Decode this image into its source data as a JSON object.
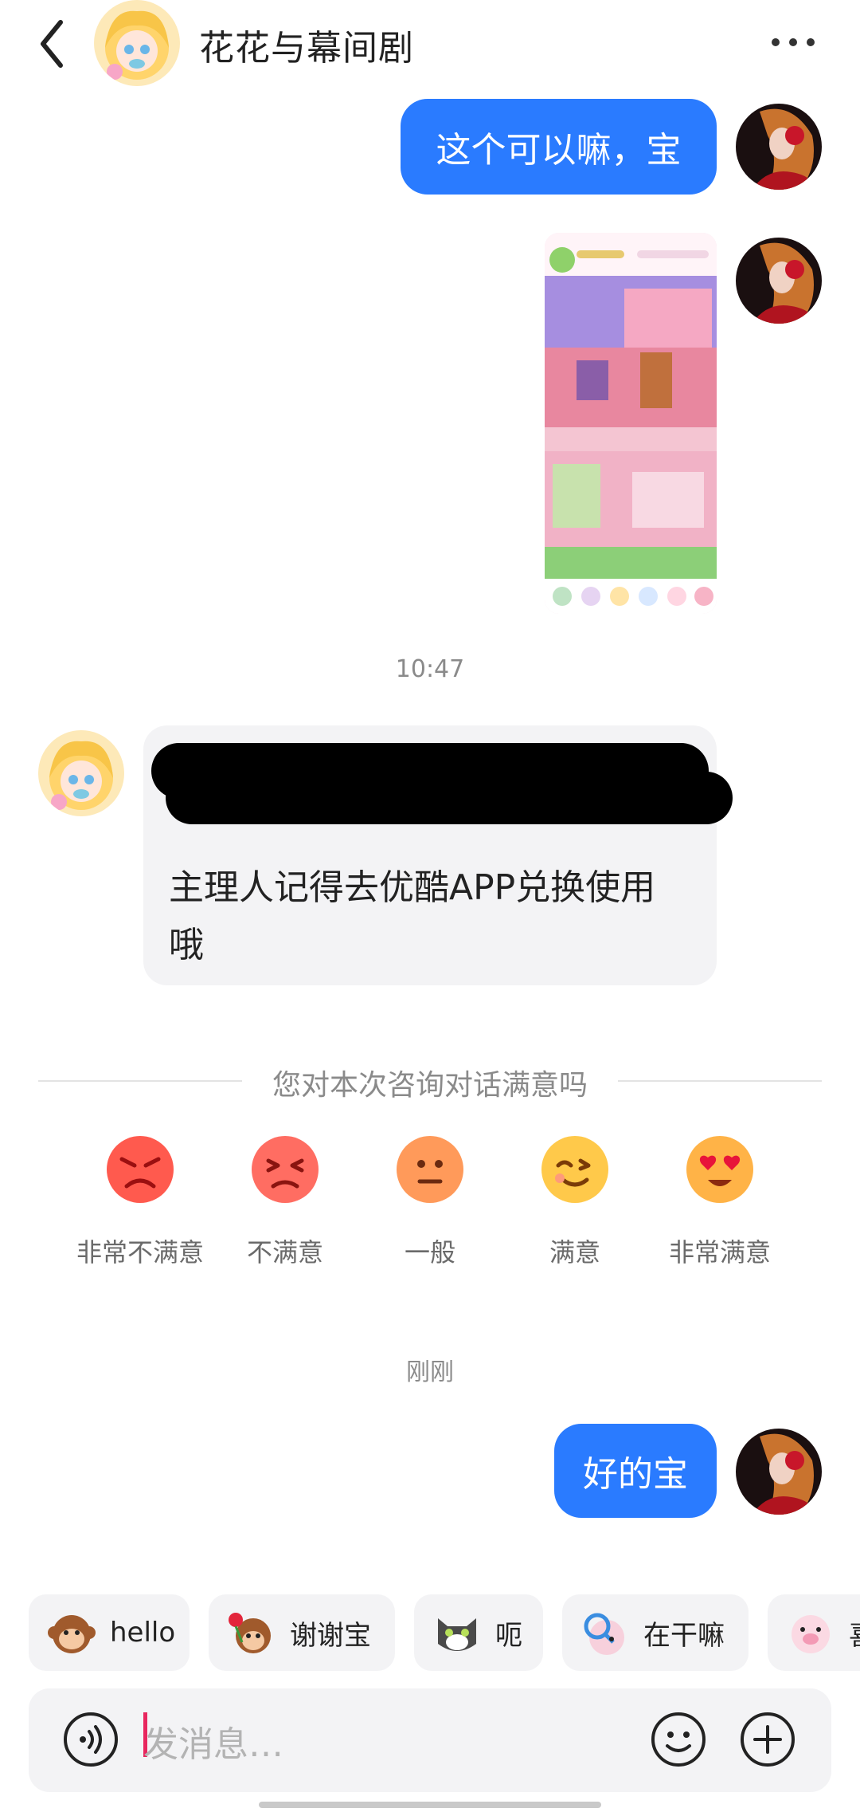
{
  "header": {
    "title": "花花与幕间剧",
    "back_icon": "chevron-left-icon",
    "more_icon": "more-dots-icon"
  },
  "messages": [
    {
      "side": "out",
      "text": "这个可以嘛，宝"
    },
    {
      "side": "out",
      "type": "image",
      "description_icon": "game-screenshot-thumbnail"
    },
    {
      "timestamp": "10:47"
    },
    {
      "side": "in",
      "text_line1": "主理人记得去优酷APP兑换使用",
      "text_line2": "哦"
    },
    {
      "timestamp": "刚刚"
    },
    {
      "side": "out",
      "text": "好的宝"
    }
  ],
  "survey": {
    "title": "您对本次咨询对话满意吗",
    "options": [
      {
        "label": "非常不满意",
        "icon": "angry-face-icon",
        "color": "#ff5a4e"
      },
      {
        "label": "不满意",
        "icon": "frown-face-icon",
        "color": "#ff6d62"
      },
      {
        "label": "一般",
        "icon": "neutral-face-icon",
        "color": "#ff9a5a"
      },
      {
        "label": "满意",
        "icon": "wink-face-icon",
        "color": "#ffc94a"
      },
      {
        "label": "非常满意",
        "icon": "heart-eyes-face-icon",
        "color": "#ffb347"
      }
    ]
  },
  "quick_replies": [
    {
      "label": "hello",
      "icon": "monkey-icon"
    },
    {
      "label": "谢谢宝",
      "icon": "monkey-rose-icon"
    },
    {
      "label": "呃",
      "icon": "cat-icon"
    },
    {
      "label": "在干嘛",
      "icon": "magnifier-monkey-icon"
    },
    {
      "label": "喜",
      "icon": "pig-icon"
    }
  ],
  "input": {
    "placeholder": "发消息…",
    "voice_icon": "voice-icon",
    "emoji_icon": "smile-icon",
    "plus_icon": "plus-circle-icon"
  },
  "colors": {
    "accent": "#2a7bff",
    "bubble_in": "#f3f3f5",
    "caret": "#e8265e"
  }
}
